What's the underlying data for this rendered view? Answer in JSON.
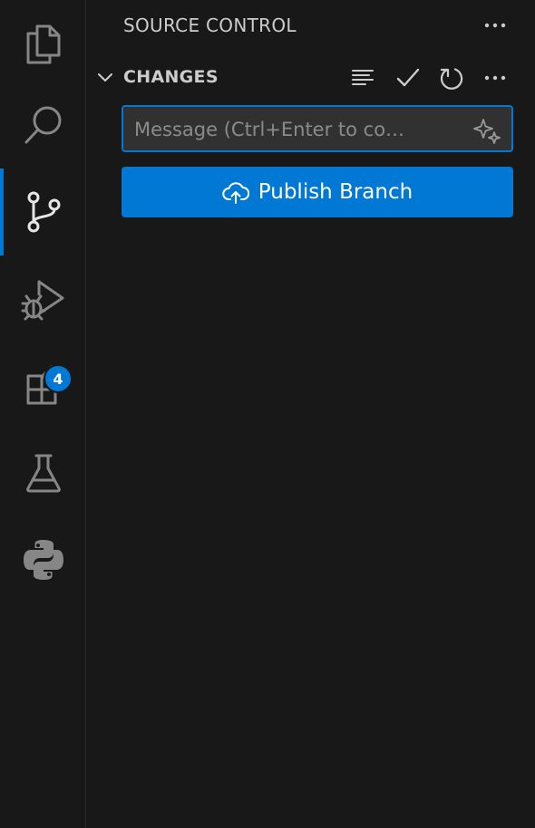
{
  "activity_bar": {
    "items": [
      {
        "icon": "files-icon",
        "label": "Explorer"
      },
      {
        "icon": "search-icon",
        "label": "Search"
      },
      {
        "icon": "source-control-icon",
        "label": "Source Control",
        "active": true
      },
      {
        "icon": "run-debug-icon",
        "label": "Run and Debug"
      },
      {
        "icon": "extensions-icon",
        "label": "Extensions",
        "badge": "4"
      },
      {
        "icon": "testing-flask-icon",
        "label": "Testing"
      },
      {
        "icon": "python-icon",
        "label": "Python"
      }
    ]
  },
  "sidebar": {
    "title": "SOURCE CONTROL",
    "section": {
      "title": "CHANGES"
    },
    "commit_message": {
      "placeholder": "Message (Ctrl+Enter to co…",
      "value": ""
    },
    "publish_button": {
      "label": "Publish Branch"
    }
  },
  "colors": {
    "background": "#181818",
    "accent": "#0078d4",
    "input_background": "#313131",
    "icon": "#cccccc",
    "inactive_icon": "#868686"
  }
}
